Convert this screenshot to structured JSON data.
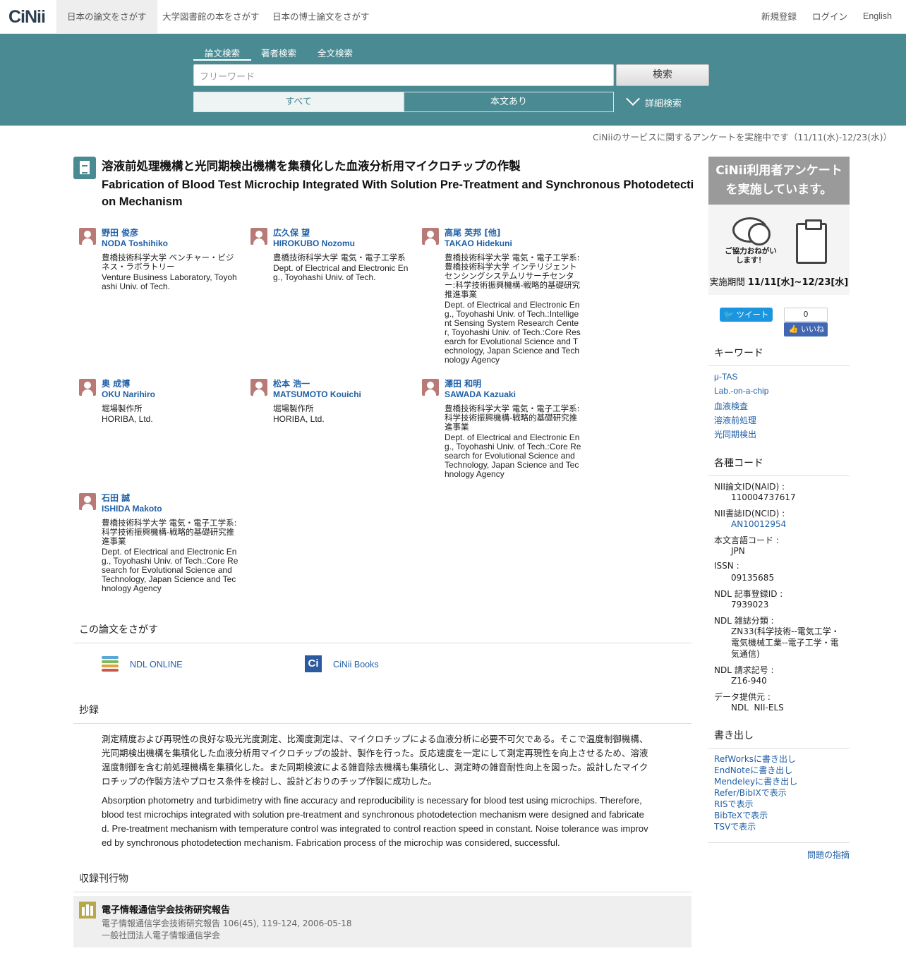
{
  "nav": {
    "logo": "CiNii",
    "tabs": [
      "日本の論文をさがす",
      "大学図書館の本をさがす",
      "日本の博士論文をさがす"
    ],
    "right": [
      "新規登録",
      "ログイン",
      "English"
    ]
  },
  "search": {
    "tabs": [
      "論文検索",
      "著者検索",
      "全文検索"
    ],
    "placeholder": "フリーワード",
    "button": "検索",
    "filter_all": "すべて",
    "filter_fulltext": "本文あり",
    "advanced": "詳細検索"
  },
  "notice": "CiNiiのサービスに関するアンケートを実施中です（11/11(水)-12/23(水)）",
  "paper": {
    "title_ja": "溶液前処理機構と光同期検出機構を集積化した血液分析用マイクロチップの作製",
    "title_en": "Fabrication of Blood Test Microchip Integrated With Solution Pre-Treatment and Synchronous Photodetection Mechanism"
  },
  "authors": [
    {
      "ja": "野田 俊彦",
      "en": "NODA Toshihiko",
      "aff_ja": "豊橋技術科学大学 ベンチャー・ビジネス・ラボラトリー",
      "aff_en": "Venture Business Laboratory, Toyohashi Univ. of Tech."
    },
    {
      "ja": "広久保 望",
      "en": "HIROKUBO Nozomu",
      "aff_ja": "豊橋技術科学大学 電気・電子工学系",
      "aff_en": "Dept. of Electrical and Electronic Eng., Toyohashi Univ. of Tech."
    },
    {
      "ja": "高尾 英邦 [他]",
      "en": "TAKAO Hidekuni",
      "aff_ja": "豊橋技術科学大学 電気・電子工学系:豊橋技術科学大学 インテリジェントセンシングシステムリサーチセンター:科学技術振興機構-戦略的基礎研究推進事業",
      "aff_en": "Dept. of Electrical and Electronic Eng., Toyohashi Univ. of Tech.:Intelligent Sensing System Research Center, Toyohashi Univ. of Tech.:Core Research for Evolutional Science and Technology, Japan Science and Technology Agency"
    },
    {
      "ja": "奥 成博",
      "en": "OKU Narihiro",
      "aff_ja": "堀場製作所",
      "aff_en": "HORIBA, Ltd."
    },
    {
      "ja": "松本 浩一",
      "en": "MATSUMOTO Kouichi",
      "aff_ja": "堀場製作所",
      "aff_en": "HORIBA, Ltd."
    },
    {
      "ja": "澤田 和明",
      "en": "SAWADA Kazuaki",
      "aff_ja": "豊橋技術科学大学 電気・電子工学系:科学技術振興機構-戦略的基礎研究推進事業",
      "aff_en": "Dept. of Electrical and Electronic Eng., Toyohashi Univ. of Tech.:Core Research for Evolutional Science and Technology, Japan Science and Technology Agency"
    },
    {
      "ja": "石田 誠",
      "en": "ISHIDA Makoto",
      "aff_ja": "豊橋技術科学大学 電気・電子工学系:科学技術振興機構-戦略的基礎研究推進事業",
      "aff_en": "Dept. of Electrical and Electronic Eng., Toyohashi Univ. of Tech.:Core Research for Evolutional Science and Technology, Japan Science and Technology Agency"
    }
  ],
  "find": {
    "heading": "この論文をさがす",
    "ndl": "NDL ONLINE",
    "cinii_books": "CiNii Books",
    "cinii_books_icon": "Ci"
  },
  "abstract": {
    "heading": "抄録",
    "ja": "測定精度および再現性の良好な吸光光度測定、比濁度測定は、マイクロチップによる血液分析に必要不可欠である。そこで温度制御機構、光同期検出機構を集積化した血液分析用マイクロチップの設計、製作を行った。反応速度を一定にして測定再現性を向上させるため、溶液温度制御を含む前処理機構を集積化した。また同期検波による雑音除去機構も集積化し、測定時の雑音耐性向上を図った。設計したマイクロチップの作製方法やプロセス条件を検討し、設計どおりのチップ作製に成功した。",
    "en": "Absorption photometry and turbidimetry with fine accuracy and reproducibility is necessary for blood test using microchips. Therefore, blood test microchips integrated with solution pre-treatment and synchronous photodetection mechanism were designed and fabricated. Pre-treatment mechanism with temperature control was integrated to control reaction speed in constant. Noise tolerance was improved by synchronous photodetection mechanism. Fabrication process of the microchip was considered, successful."
  },
  "journal": {
    "heading": "収録刊行物",
    "title": "電子情報通信学会技術研究報告",
    "citation": "電子情報通信学会技術研究報告 106(45), 119-124, 2006-05-18",
    "publisher": "一般社団法人電子情報通信学会"
  },
  "banner": {
    "title_line1": "CiNii利用者アンケート",
    "title_line2": "を実施しています。",
    "message": "ご協力おねがいします！",
    "period_label": "実施期間",
    "period": "11/11[水]~12/23[水]"
  },
  "social": {
    "tweet": "ツイート",
    "fb_count": "0",
    "fb_like": "いいね"
  },
  "keywords": {
    "heading": "キーワード",
    "items": [
      "μ-TAS",
      "Lab.-on-a-chip",
      "血液検査",
      "溶液前処理",
      "光同期検出"
    ]
  },
  "codes": {
    "heading": "各種コード",
    "items": [
      {
        "label": "NII論文ID(NAID) :",
        "value": "110004737617"
      },
      {
        "label": "NII書誌ID(NCID) :",
        "value": "AN10012954"
      },
      {
        "label": "本文言語コード :",
        "value": "JPN"
      },
      {
        "label": "ISSN :",
        "value": "09135685"
      },
      {
        "label": "NDL 記事登録ID :",
        "value": "7939023"
      },
      {
        "label": "NDL 雑誌分類 :",
        "value": "ZN33(科学技術--電気工学・電気機械工業--電子工学・電気通信)"
      },
      {
        "label": "NDL 請求記号 :",
        "value": "Z16-940"
      },
      {
        "label": "データ提供元 :",
        "value": "NDL  NII-ELS"
      }
    ]
  },
  "export": {
    "heading": "書き出し",
    "items": [
      "RefWorksに書き出し",
      "EndNoteに書き出し",
      "Mendeleyに書き出し",
      "Refer/BibIXで表示",
      "RISで表示",
      "BibTeXで表示",
      "TSVで表示"
    ]
  },
  "report": "問題の指摘",
  "colors": {
    "band": "#4a8a93",
    "link": "#1f5fa6",
    "avatar": "#b87a76",
    "journal_icon": "#b7a84d"
  }
}
